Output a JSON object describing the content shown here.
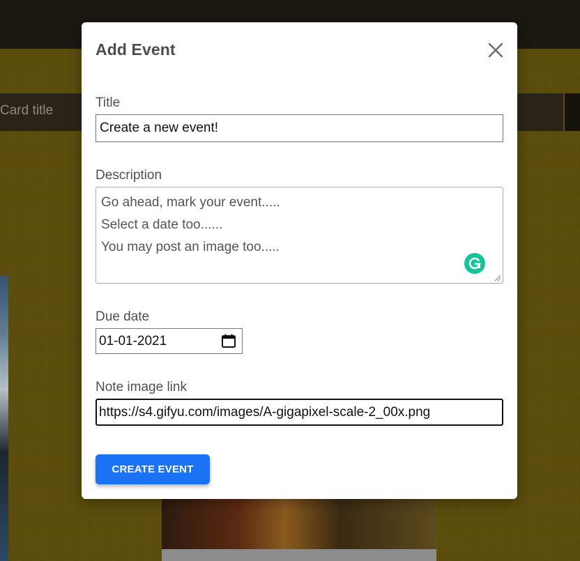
{
  "background": {
    "card_title_peek": "Card title"
  },
  "modal": {
    "title": "Add Event",
    "close_icon": "close-icon",
    "fields": {
      "title": {
        "label": "Title",
        "value": "Create a new event!"
      },
      "description": {
        "label": "Description",
        "lines": [
          "Go ahead, mark your event.....",
          "Select a date too......",
          "You may post an image too....."
        ]
      },
      "due_date": {
        "label": "Due date",
        "value": "01-01-2021",
        "icon": "calendar-icon"
      },
      "image_link": {
        "label": "Note image link",
        "value": "https://s4.gifyu.com/images/A-gigapixel-scale-2_00x.png"
      }
    },
    "submit_label": "CREATE EVENT"
  },
  "colors": {
    "topbar": "#1b1711",
    "backdrop": "#5f500d",
    "primary_button": "#1a73f5",
    "grammarly": "#15c39a"
  }
}
